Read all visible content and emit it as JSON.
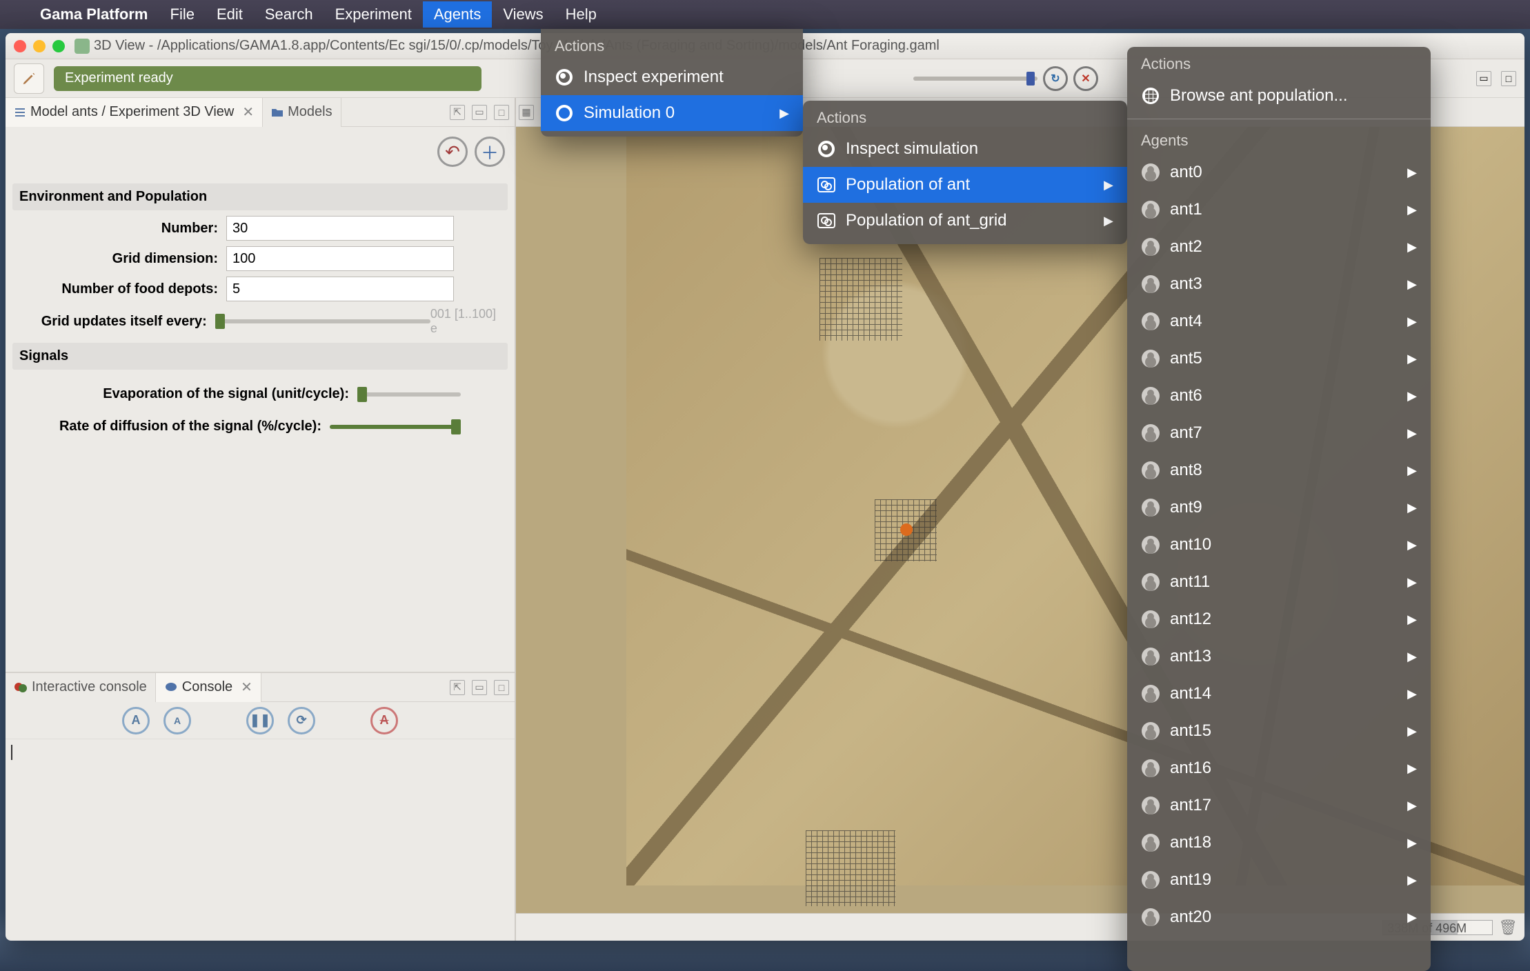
{
  "macmenu": {
    "app": "Gama Platform",
    "items": [
      "File",
      "Edit",
      "Search",
      "Experiment",
      "Agents",
      "Views",
      "Help"
    ],
    "selected": "Agents"
  },
  "window": {
    "title": "3D View - /Applications/GAMA1.8.app/Contents/Ec                              sgi/15/0/.cp/models/Toy Models/Ants (Foraging and Sorting)/models/Ant Foraging.gaml"
  },
  "toolbar": {
    "status": "Experiment ready"
  },
  "left": {
    "tab_active": "Model ants / Experiment 3D View",
    "tab_models": "Models",
    "groups": {
      "env": {
        "title": "Environment and Population",
        "number_label": "Number:",
        "number_value": "30",
        "grid_label": "Grid dimension:",
        "grid_value": "100",
        "food_label": "Number of food depots:",
        "food_value": "5",
        "update_label": "Grid updates itself every:",
        "update_hint": "001 [1..100] e"
      },
      "sig": {
        "title": "Signals",
        "evap_label": "Evaporation of the signal (unit/cycle):",
        "diff_label": "Rate of diffusion of the signal (%/cycle):"
      }
    },
    "console": {
      "tab_interactive": "Interactive console",
      "tab_console": "Console"
    }
  },
  "status": {
    "mem_text": "338M of 496M",
    "mem_pct": 68
  },
  "menus": {
    "m1": {
      "section": "Actions",
      "inspect": "Inspect experiment",
      "sim": "Simulation 0"
    },
    "m2": {
      "section": "Actions",
      "inspect": "Inspect simulation",
      "pop_ant": "Population of ant",
      "pop_grid": "Population of ant_grid"
    },
    "m3": {
      "section_actions": "Actions",
      "browse": "Browse ant population...",
      "section_agents": "Agents",
      "agents": [
        "ant0",
        "ant1",
        "ant2",
        "ant3",
        "ant4",
        "ant5",
        "ant6",
        "ant7",
        "ant8",
        "ant9",
        "ant10",
        "ant11",
        "ant12",
        "ant13",
        "ant14",
        "ant15",
        "ant16",
        "ant17",
        "ant18",
        "ant19",
        "ant20"
      ]
    }
  }
}
